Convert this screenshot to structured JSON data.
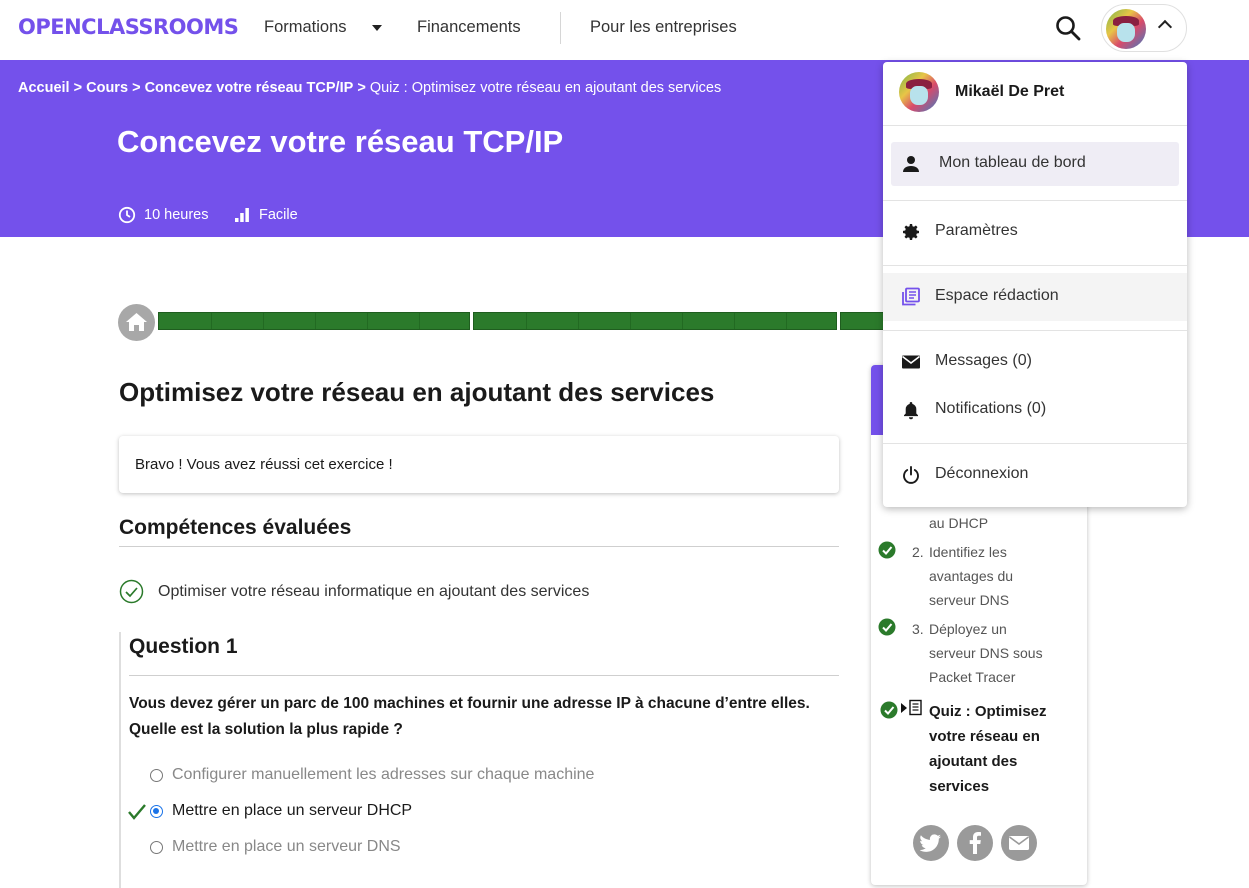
{
  "nav": {
    "logo": "OPENCLASSROOMS",
    "formations": "Formations",
    "financements": "Financements",
    "entreprises": "Pour les entreprises"
  },
  "breadcrumb": {
    "home": "Accueil",
    "courses": "Cours",
    "course": "Concevez votre réseau TCP/IP",
    "current": "Quiz : Optimisez votre réseau en ajoutant des services",
    "separator": ">"
  },
  "course": {
    "title": "Concevez votre réseau TCP/IP",
    "duration": "10 heures",
    "level": "Facile"
  },
  "quiz": {
    "title": "Optimisez votre réseau en ajoutant des services",
    "result": "Bravo ! Vous avez réussi cet exercice !",
    "skills_heading": "Compétences évaluées",
    "skill": "Optimiser votre réseau informatique en ajoutant des services",
    "question": {
      "title": "Question 1",
      "text": "Vous devez gérer un parc de 100 machines et fournir une adresse IP à chacune d’entre elles. Quelle est la solution la plus rapide ?",
      "answers": [
        {
          "label": "Configurer manuellement les adresses sur chaque machine",
          "selected": false
        },
        {
          "label": "Mettre en place un serveur DHCP",
          "selected": true
        },
        {
          "label": "Mettre en place un serveur DNS",
          "selected": false
        }
      ]
    }
  },
  "sidebar": {
    "item0_tail": "au DHCP",
    "item1_num": "2.",
    "item1_a": "Identifiez les",
    "item1_b": "avantages du",
    "item1_c": "serveur DNS",
    "item2_num": "3.",
    "item2_a": "Déployez un",
    "item2_b": "serveur DNS sous",
    "item2_c": "Packet Tracer",
    "current": "Quiz : Optimisez votre réseau en ajoutant des services"
  },
  "dropdown": {
    "user_name": "Mikaël De Pret",
    "dashboard": "Mon tableau de bord",
    "settings": "Paramètres",
    "editorial": "Espace rédaction",
    "messages": "Messages (0)",
    "notifications": "Notifications (0)",
    "logout": "Déconnexion"
  },
  "colors": {
    "brand": "#7451eb",
    "progress": "#2b7a2b",
    "check": "#2b7a2b",
    "radio": "#1a73e8"
  },
  "icons": [
    "search-icon",
    "chevron-up-icon",
    "clock-icon",
    "level-bars-icon",
    "home-icon",
    "check-circle-icon",
    "checkmark-icon",
    "person-icon",
    "gear-icon",
    "library-icon",
    "mail-icon",
    "bell-icon",
    "power-icon",
    "twitter-icon",
    "facebook-icon",
    "email-share-icon"
  ]
}
